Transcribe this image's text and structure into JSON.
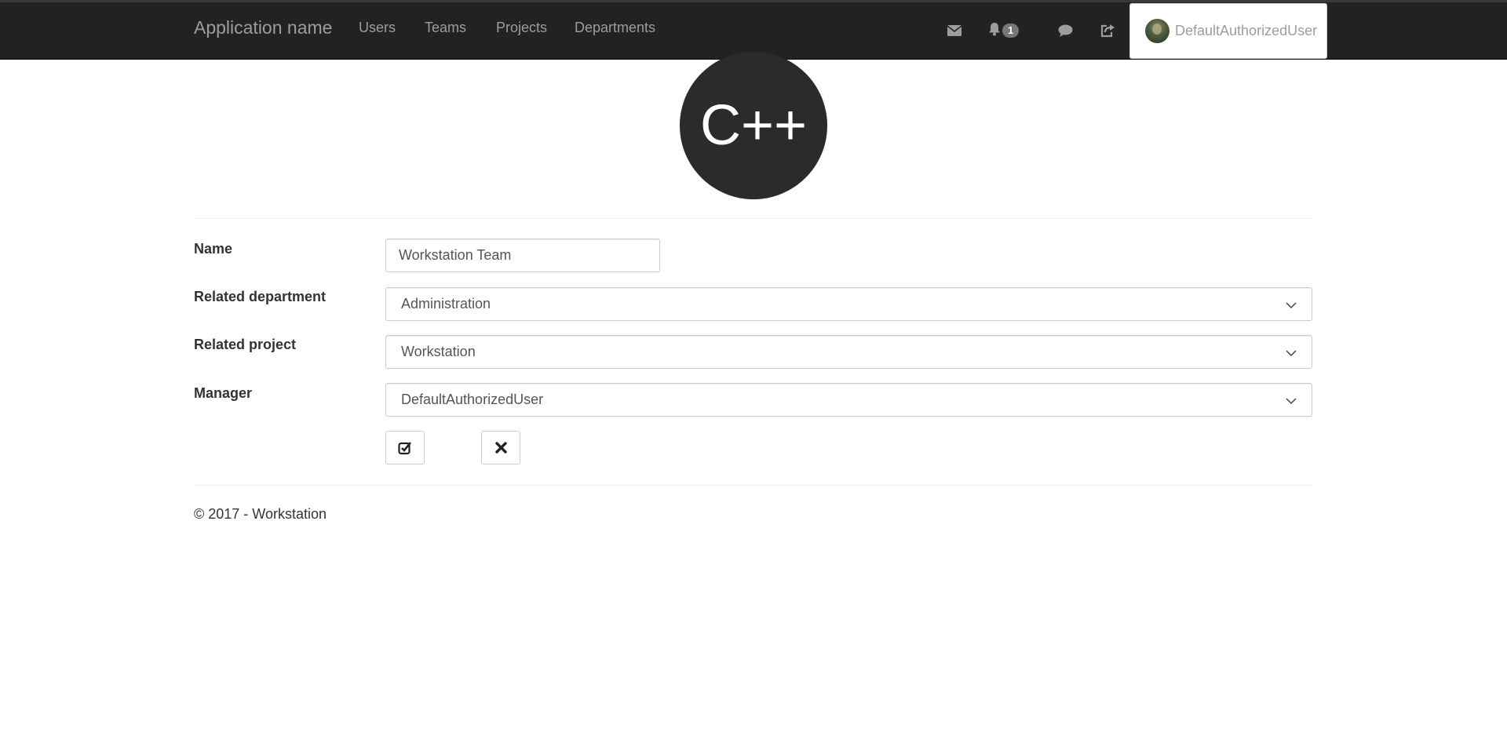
{
  "navbar": {
    "brand": "Application name",
    "links": [
      "Users",
      "Teams",
      "Projects",
      "Departments"
    ],
    "icons": [
      "envelope-icon",
      "bell-icon",
      "comment-icon",
      "share-icon"
    ],
    "notification_count": "1",
    "user_name": "DefaultAuthorizedUser"
  },
  "logo": {
    "text": "C++"
  },
  "form": {
    "name_label": "Name",
    "name_value": "Workstation Team",
    "department_label": "Related department",
    "department_value": "Administration",
    "project_label": "Related project",
    "project_value": "Workstation",
    "manager_label": "Manager",
    "manager_value": "DefaultAuthorizedUser",
    "save_icon": "check-square-icon",
    "cancel_icon": "times-icon"
  },
  "footer": {
    "text": "© 2017 - Workstation"
  },
  "colors": {
    "navbar_bg": "#222222",
    "nav_text": "#9d9d9d",
    "logo_bg": "#2b2b2b",
    "badge_bg": "#777777"
  }
}
